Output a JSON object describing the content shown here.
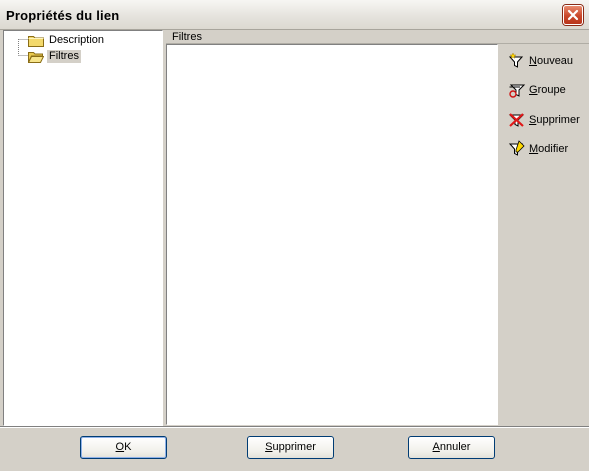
{
  "window": {
    "title": "Propriétés du lien",
    "close_icon": "close-icon"
  },
  "tree": {
    "items": [
      {
        "label": "Description",
        "icon": "folder-icon",
        "selected": false
      },
      {
        "label": "Filtres",
        "icon": "folder-open-icon",
        "selected": true
      }
    ]
  },
  "filters": {
    "header": "Filtres",
    "rows": []
  },
  "toolbar": {
    "buttons": [
      {
        "label": "Nouveau",
        "accel": "N",
        "rest": "ouveau",
        "icon": "new-filter-icon"
      },
      {
        "label": "Groupe",
        "accel": "G",
        "rest": "roupe",
        "icon": "group-filter-icon"
      },
      {
        "label": "Supprimer",
        "accel": "S",
        "rest": "upprimer",
        "icon": "delete-filter-icon"
      },
      {
        "label": "Modifier",
        "accel": "M",
        "rest": "odifier",
        "icon": "edit-filter-icon"
      }
    ]
  },
  "footer": {
    "ok_accel": "O",
    "ok_rest": "K",
    "delete_accel": "S",
    "delete_rest": "upprimer",
    "cancel_accel": "A",
    "cancel_rest": "nnuler"
  },
  "colors": {
    "dialog_bg": "#d4d0c8",
    "close_red": "#c9472a",
    "button_border": "#003c74"
  }
}
